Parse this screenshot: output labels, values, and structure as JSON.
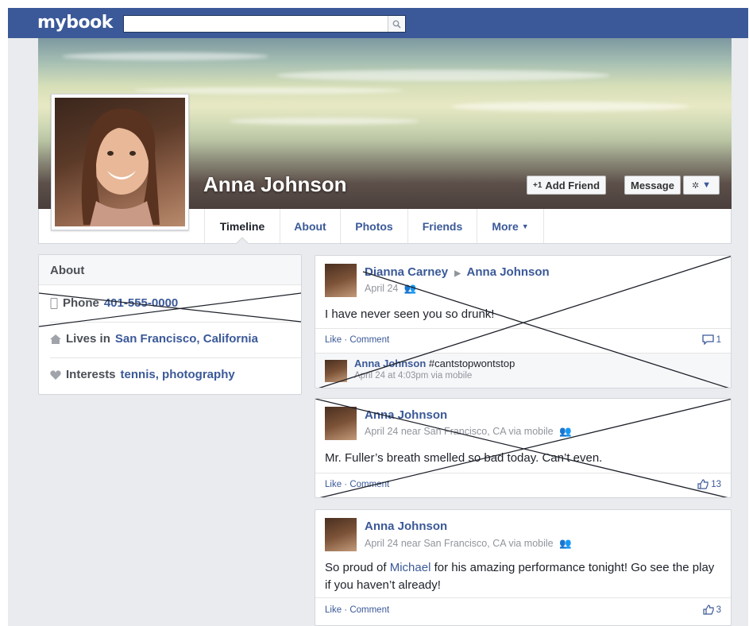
{
  "app": {
    "logo": "mybook"
  },
  "search": {
    "placeholder": ""
  },
  "profile": {
    "name": "Anna Johnson"
  },
  "buttons": {
    "add_friend": "Add Friend",
    "message": "Message"
  },
  "nav": {
    "tabs": [
      "Timeline",
      "About",
      "Photos",
      "Friends",
      "More"
    ]
  },
  "about": {
    "title": "About",
    "phone_label": "Phone",
    "phone_value": "401-555-0000",
    "lives_label": "Lives in",
    "lives_value": "San Francisco, California",
    "interests_label": "Interests",
    "interests_value": "tennis, photography"
  },
  "posts": [
    {
      "author": "Dianna Carney",
      "target": "Anna Johnson",
      "date": "April 24",
      "text": "I have never seen you so drunk!",
      "actions": "Like · Comment",
      "count": "1",
      "comment": {
        "author": "Anna Johnson",
        "text": "#cantstopwontstop",
        "meta": "April 24 at 4:03pm via mobile"
      }
    },
    {
      "author": "Anna Johnson",
      "meta": "April 24 near San Francisco, CA via mobile",
      "text": "Mr. Fuller’s breath smelled so bad today. Can’t even.",
      "actions": "Like · Comment",
      "count": "13"
    },
    {
      "author": "Anna Johnson",
      "meta": "April 24 near San Francisco, CA via mobile",
      "text_before": "So proud of ",
      "text_link": "Michael",
      "text_after": " for his amazing performance tonight! Go see the play if you haven’t already!",
      "actions": "Like · Comment",
      "count": "3"
    }
  ]
}
